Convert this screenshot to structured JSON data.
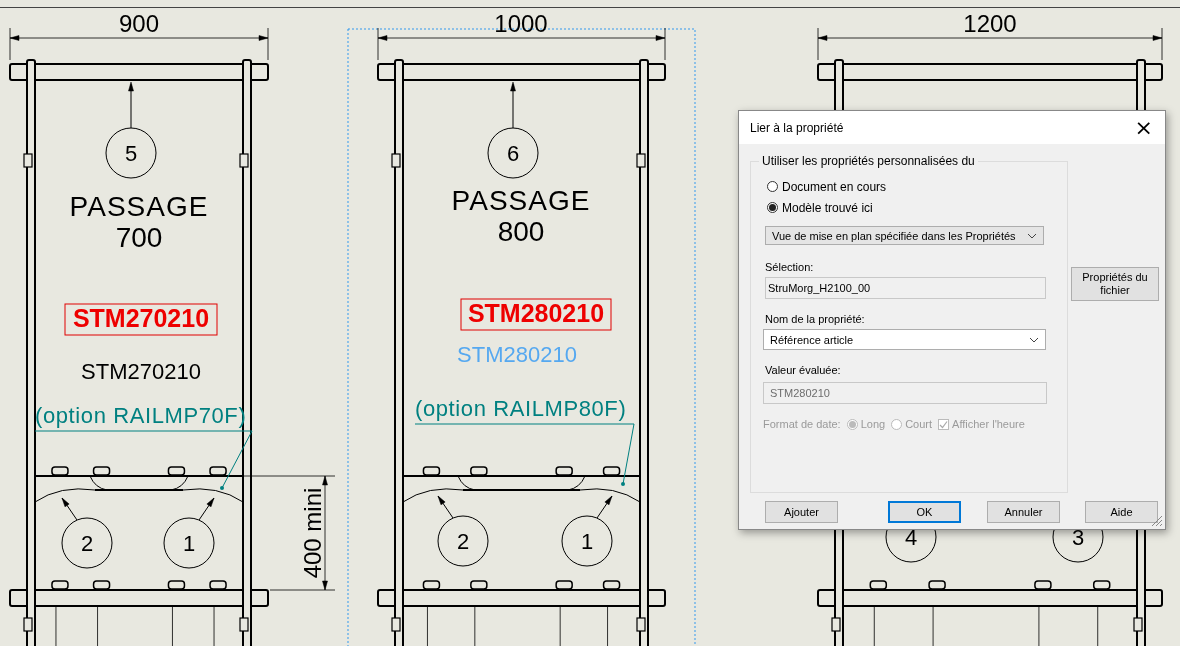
{
  "drawing": {
    "frames": [
      {
        "selected": false,
        "dimension": "900",
        "top_balloon": "5",
        "passage_title": "PASSAGE",
        "passage_value": "700",
        "reference_box": "STM270210",
        "reference_text": {
          "text": "STM270210",
          "selected": false
        },
        "option_note": "(option RAILMP70F)",
        "lower_balloons": [
          "2",
          "1"
        ],
        "height_dimension": "400 mini"
      },
      {
        "selected": true,
        "dimension": "1000",
        "top_balloon": "6",
        "passage_title": "PASSAGE",
        "passage_value": "800",
        "reference_box": "STM280210",
        "reference_text": {
          "text": "STM280210",
          "selected": true
        },
        "option_note": "(option RAILMP80F)",
        "lower_balloons": [
          "2",
          "1"
        ]
      },
      {
        "selected": false,
        "dimension": "1200",
        "lower_balloons": [
          "4",
          "3"
        ]
      }
    ]
  },
  "dialog": {
    "title": "Lier à la propriété",
    "close": "×",
    "group_title": "Utiliser les propriétés personnalisées du",
    "sources": [
      {
        "label": "Document en cours",
        "selected": false
      },
      {
        "label": "Modèle trouvé ici",
        "selected": true
      }
    ],
    "view_dropdown": "Vue de mise en plan spécifiée dans les Propriétés",
    "selection_label": "Sélection:",
    "selection_value": "StruMorg_H2100_00",
    "file_properties_button": "Propriétés du fichier",
    "property_label": "Nom de la propriété:",
    "property_dropdown": "Référence article",
    "evaluated_label": "Valeur évaluée:",
    "evaluated_value": "STM280210",
    "date_format": {
      "label": "Format de date:",
      "disabled": true,
      "options": [
        {
          "label": "Long",
          "selected": true
        },
        {
          "label": "Court",
          "selected": false
        }
      ],
      "show_time": {
        "label": "Afficher l'heure",
        "checked": true
      }
    },
    "buttons": [
      {
        "label": "Ajouter",
        "default": false
      },
      {
        "label": "OK",
        "default": true
      },
      {
        "label": "Annuler",
        "default": false
      },
      {
        "label": "Aide",
        "default": false
      }
    ]
  }
}
